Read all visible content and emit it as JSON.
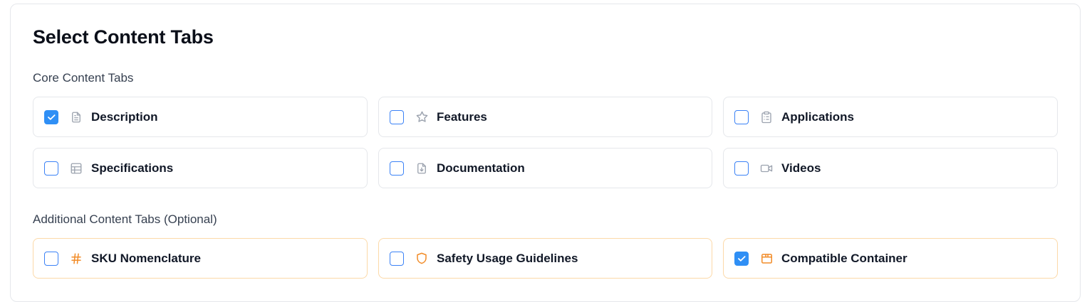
{
  "title": "Select Content Tabs",
  "colors": {
    "accent": "#2f8ff5",
    "optional_icon": "#f28c28",
    "core_icon": "#9ca3af"
  },
  "core": {
    "label": "Core Content Tabs",
    "items": [
      {
        "label": "Description",
        "icon": "file-text-icon",
        "checked": true
      },
      {
        "label": "Features",
        "icon": "star-icon",
        "checked": false
      },
      {
        "label": "Applications",
        "icon": "clipboard-list-icon",
        "checked": false
      },
      {
        "label": "Specifications",
        "icon": "table-icon",
        "checked": false
      },
      {
        "label": "Documentation",
        "icon": "file-download-icon",
        "checked": false
      },
      {
        "label": "Videos",
        "icon": "video-icon",
        "checked": false
      }
    ]
  },
  "additional": {
    "label": "Additional Content Tabs (Optional)",
    "items": [
      {
        "label": "SKU Nomenclature",
        "icon": "hash-icon",
        "checked": false
      },
      {
        "label": "Safety Usage Guidelines",
        "icon": "shield-icon",
        "checked": false
      },
      {
        "label": "Compatible Container",
        "icon": "package-icon",
        "checked": true
      }
    ]
  }
}
